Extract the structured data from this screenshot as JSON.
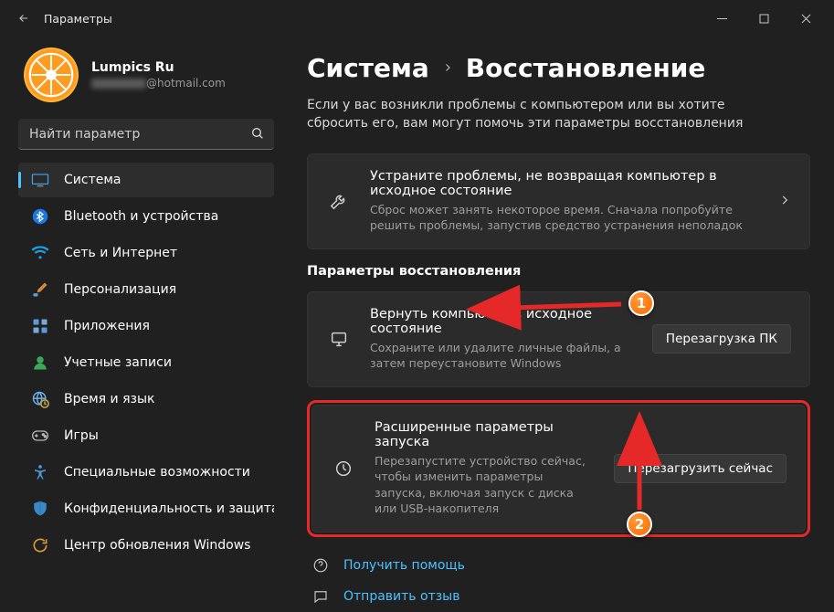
{
  "window": {
    "title": "Параметры"
  },
  "profile": {
    "name": "Lumpics Ru",
    "email_suffix": "@hotmail.com"
  },
  "search": {
    "placeholder": "Найти параметр"
  },
  "nav": {
    "items": [
      {
        "label": "Система",
        "icon": "monitor",
        "active": true
      },
      {
        "label": "Bluetooth и устройства",
        "icon": "bluetooth"
      },
      {
        "label": "Сеть и Интернет",
        "icon": "wifi"
      },
      {
        "label": "Персонализация",
        "icon": "brush"
      },
      {
        "label": "Приложения",
        "icon": "apps"
      },
      {
        "label": "Учетные записи",
        "icon": "person"
      },
      {
        "label": "Время и язык",
        "icon": "globe-clock"
      },
      {
        "label": "Игры",
        "icon": "gamepad"
      },
      {
        "label": "Специальные возможности",
        "icon": "accessibility"
      },
      {
        "label": "Конфиденциальность и защита",
        "icon": "shield"
      },
      {
        "label": "Центр обновления Windows",
        "icon": "update"
      }
    ]
  },
  "breadcrumb": {
    "root": "Система",
    "current": "Восстановление"
  },
  "intro": "Если у вас возникли проблемы с компьютером или вы хотите сбросить его, вам могут помочь эти параметры восстановления",
  "troubleshoot": {
    "title": "Устраните проблемы, не возвращая компьютер в исходное состояние",
    "desc": "Сброс может занять некоторое время. Сначала попробуйте решить проблемы, запустив средство устранения неполадок"
  },
  "section_title": "Параметры восстановления",
  "reset": {
    "title": "Вернуть компьютер в исходное состояние",
    "desc": "Сохраните или удалите личные файлы, а затем переустановите Windows",
    "button": "Перезагрузка ПК"
  },
  "advanced": {
    "title": "Расширенные параметры запуска",
    "desc": "Перезапустите устройство сейчас, чтобы изменить параметры запуска, включая запуск с диска или USB-накопителя",
    "button": "Перезагрузить сейчас"
  },
  "links": {
    "help": "Получить помощь",
    "feedback": "Отправить отзыв"
  },
  "annotations": {
    "badge1": "1",
    "badge2": "2"
  },
  "colors": {
    "accent": "#4cc2ff",
    "highlight": "#e52828",
    "badge": "#ff7a1a"
  }
}
